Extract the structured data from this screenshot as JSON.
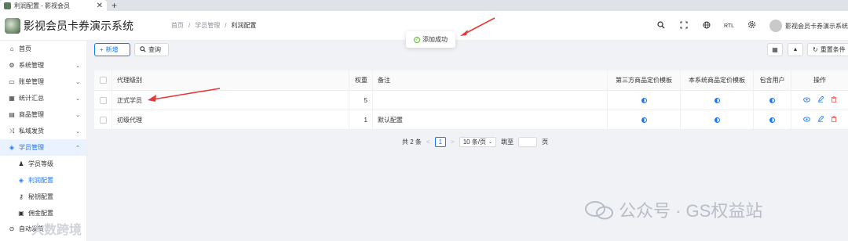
{
  "browser": {
    "tab_title": "利润配置 - 影视会员",
    "close_glyph": "✕",
    "new_tab_glyph": "+"
  },
  "header": {
    "app_title": "影视会员卡券演示系统",
    "breadcrumb": [
      "首页",
      "学员管理",
      "利润配置"
    ],
    "breadcrumb_sep": "/",
    "icons": [
      "search-icon",
      "fullscreen-icon",
      "globe-icon",
      "rtl-toggle",
      "gear-icon"
    ],
    "rtl_label": "RTL",
    "username": "影视会员卡券演示系统"
  },
  "sidebar": {
    "items": [
      {
        "label": "首页",
        "icon": "home-icon",
        "glyph": "⌂",
        "chevron": ""
      },
      {
        "label": "系统管理",
        "icon": "settings-icon",
        "glyph": "⚙",
        "chevron": "⌄"
      },
      {
        "label": "账单管理",
        "icon": "bill-icon",
        "glyph": "▭",
        "chevron": "⌄"
      },
      {
        "label": "统计汇总",
        "icon": "stats-icon",
        "glyph": "▦",
        "chevron": "⌄"
      },
      {
        "label": "商品管理",
        "icon": "goods-icon",
        "glyph": "▤",
        "chevron": "⌄"
      },
      {
        "label": "私域发货",
        "icon": "shuffle-icon",
        "glyph": "⤨",
        "chevron": "⌄"
      },
      {
        "label": "学员管理",
        "icon": "tag-icon",
        "glyph": "◈",
        "chevron": "⌃"
      }
    ],
    "sub_items": [
      {
        "label": "学员等级",
        "glyph": "♟"
      },
      {
        "label": "利润配置",
        "glyph": "◈"
      },
      {
        "label": "秘钥配置",
        "glyph": "⚷"
      },
      {
        "label": "佣金配置",
        "glyph": "▣"
      },
      {
        "label": "自动发货",
        "glyph": "⊙"
      }
    ]
  },
  "toolbar": {
    "add_label": "新增",
    "query_label": "查询",
    "reset_label": "重置条件"
  },
  "table": {
    "columns": [
      "代理级别",
      "权重",
      "备注",
      "第三方商品定价模板",
      "本系统商品定价模板",
      "包含用户",
      "操作"
    ],
    "rows": [
      {
        "level": "正式学员",
        "weight": "5",
        "remark": ""
      },
      {
        "level": "初级代理",
        "weight": "1",
        "remark": "默认配置"
      }
    ]
  },
  "pagination": {
    "total": "共 2 条",
    "prev": "<",
    "page": "1",
    "next": ">",
    "page_size": "10 条/页",
    "jump_label": "跳至",
    "page_suffix": "页"
  },
  "toast": {
    "message": "添加成功",
    "color": "#52c41a"
  },
  "watermark": {
    "text": "公众号 · GS权益站",
    "bottom": "大数跨境"
  },
  "colors": {
    "accent": "#1677ff",
    "success": "#52c41a",
    "danger": "#ff4d4f",
    "arrow": "#e53935"
  }
}
